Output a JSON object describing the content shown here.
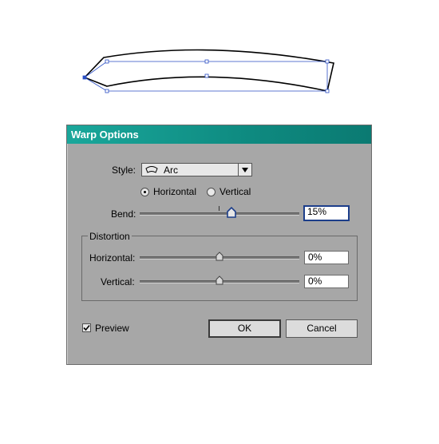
{
  "dialog": {
    "title": "Warp Options",
    "style_label": "Style:",
    "style_value": "Arc",
    "style_icon": "arc-warp-icon",
    "orientation_options": [
      "Horizontal",
      "Vertical"
    ],
    "orientation_selected": "Horizontal",
    "bend_label": "Bend:",
    "bend_value": "15%",
    "bend_fraction": 0.575,
    "distortion": {
      "title": "Distortion",
      "horizontal_label": "Horizontal:",
      "horizontal_value": "0%",
      "horizontal_fraction": 0.5,
      "vertical_label": "Vertical:",
      "vertical_value": "0%",
      "vertical_fraction": 0.5
    },
    "preview_label": "Preview",
    "preview_checked": true,
    "ok_label": "OK",
    "cancel_label": "Cancel",
    "accent_color": "#0e8a80",
    "selection_color": "#2b4fc4"
  }
}
